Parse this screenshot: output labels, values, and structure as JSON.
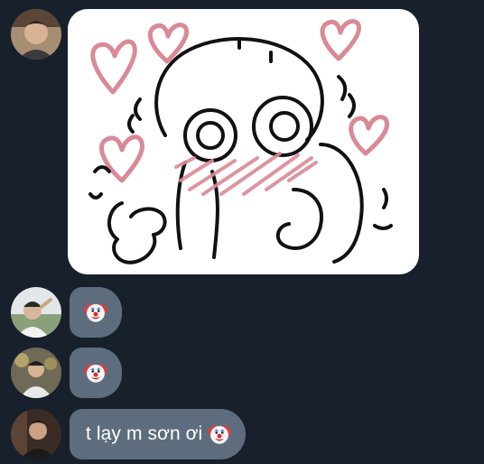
{
  "messages": [
    {
      "type": "sticker",
      "sender": "user-1",
      "image": "love-hearts-blushing-cartoon"
    },
    {
      "type": "emoji",
      "sender": "user-2",
      "emoji": "clown-face"
    },
    {
      "type": "emoji",
      "sender": "user-3",
      "emoji": "clown-face"
    },
    {
      "type": "text",
      "sender": "user-1",
      "text": "t lạy m sơn ơi",
      "emoji": "clown-face"
    }
  ],
  "colors": {
    "background": "#18202b",
    "bubble": "#5d6d7d",
    "text": "#ffffff",
    "sticker_ink": "#111111",
    "sticker_pink": "#d98a96"
  }
}
